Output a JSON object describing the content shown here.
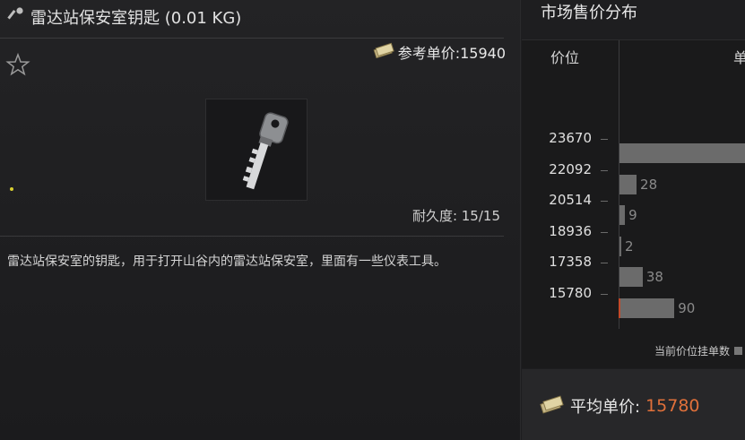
{
  "item": {
    "title": "雷达站保安室钥匙 (0.01 KG)",
    "ref_price_label": "参考单价:15940",
    "durability_label": "耐久度: 15/15",
    "description": "雷达站保安室的钥匙，用于打开山谷内的雷达站保安室，里面有一些仪表工具。",
    "icons": [
      "key-icon",
      "star-icon",
      "money-icon"
    ]
  },
  "market": {
    "title": "市场售价分布",
    "col_price": "价位",
    "col_qty": "单",
    "legend": "当前价位挂单数",
    "avg_label": "平均单价:",
    "avg_value": "15780",
    "accent_color": "#e0703a"
  },
  "chart_data": {
    "type": "bar",
    "orientation": "horizontal",
    "ticks": [
      "23670",
      "22092",
      "20514",
      "18936",
      "17358",
      "15780"
    ],
    "series": [
      {
        "name": "当前价位挂单数",
        "values": [
          {
            "price": "22881",
            "count": null,
            "label": ""
          },
          {
            "price": "21303",
            "count": 28,
            "label": "28"
          },
          {
            "price": "19725",
            "count": 9,
            "label": "9"
          },
          {
            "price": "18147",
            "count": 2,
            "label": "2"
          },
          {
            "price": "16569",
            "count": 38,
            "label": "38"
          },
          {
            "price": "15780",
            "count": 90,
            "label": "90"
          }
        ]
      }
    ],
    "current_price": "15780"
  }
}
